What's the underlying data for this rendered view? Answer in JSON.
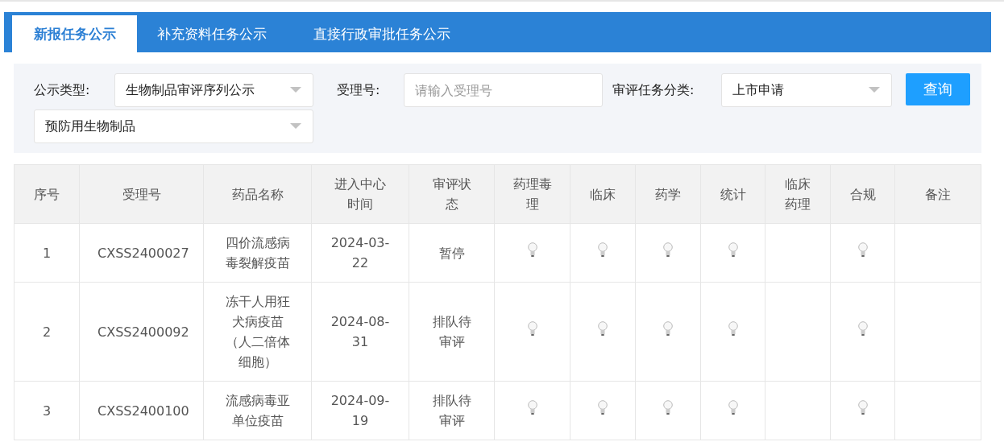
{
  "tabs": [
    {
      "label": "新报任务公示",
      "selected": true
    },
    {
      "label": "补充资料任务公示",
      "selected": false
    },
    {
      "label": "直接行政审批任务公示",
      "selected": false
    }
  ],
  "filters": [
    {
      "kind": "select",
      "label": "公示类型:",
      "value": "生物制品审评序列公示"
    },
    {
      "kind": "input",
      "label": "受理号:",
      "placeholder": "请输入受理号"
    },
    {
      "kind": "select",
      "label": "审评任务分类:",
      "value": "上市申请"
    },
    {
      "kind": "button",
      "label": "查询"
    },
    {
      "kind": "select",
      "value": "预防用生物制品"
    }
  ],
  "table": {
    "columns": [
      "序号",
      "受理号",
      "药品名称",
      "进入中心时间",
      "审评状态",
      "药理毒理",
      "临床",
      "药学",
      "统计",
      "临床药理",
      "合规",
      "备注"
    ],
    "rows": [
      {
        "index": "1",
        "receipt": "CXSS2400027",
        "name": "四价流感病毒裂解疫苗",
        "date": "2024-03-22",
        "status": "暂停",
        "bulbs": [
          true,
          true,
          true,
          true,
          false,
          true
        ]
      },
      {
        "index": "2",
        "receipt": "CXSS2400092",
        "name": "冻干人用狂犬病疫苗（人二倍体细胞）",
        "date": "2024-08-31",
        "status": "排队待审评",
        "bulbs": [
          true,
          true,
          true,
          true,
          false,
          true
        ]
      },
      {
        "index": "3",
        "receipt": "CXSS2400100",
        "name": "流感病毒亚单位疫苗",
        "date": "2024-09-19",
        "status": "排队待审评",
        "bulbs": [
          true,
          true,
          true,
          true,
          false,
          true
        ]
      }
    ]
  }
}
